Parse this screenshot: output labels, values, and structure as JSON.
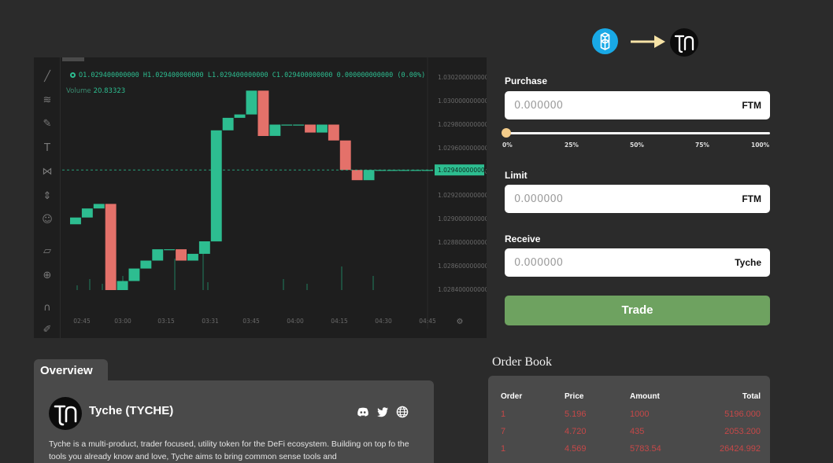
{
  "chart": {
    "ohlc": {
      "open_label": "O",
      "open": "1.029400000000",
      "high_label": "H",
      "high": "1.029400000000",
      "low_label": "L",
      "low": "1.029400000000",
      "close_label": "C",
      "close": "1.029400000000",
      "change": "0.000000000000 (0.00%)"
    },
    "volume_label": "Volume",
    "volume_value": "20.83323",
    "current_price": "1.029400000000",
    "y_ticks": [
      "1.030200000000",
      "1.030000000000",
      "1.029800000000",
      "1.029600000000",
      "1.029400000000",
      "1.029200000000",
      "1.029000000000",
      "1.028800000000",
      "1.028600000000",
      "1.028400000000"
    ],
    "x_ticks": [
      "02:45",
      "03:00",
      "03:15",
      "03:31",
      "03:45",
      "04:00",
      "04:15",
      "04:30",
      "04:45"
    ],
    "colors": {
      "up": "#2dbd90",
      "down": "#e4716a",
      "background": "#1e1e1e"
    },
    "tools": [
      "trend-line-icon",
      "fib-icon",
      "brush-icon",
      "text-icon",
      "pattern-icon",
      "measure-icon",
      "emoji-icon",
      "ruler-icon",
      "zoom-icon",
      "magnet-icon",
      "lock-icon"
    ]
  },
  "chart_data": {
    "type": "candlestick",
    "xlabel": "",
    "ylabel": "",
    "x": [
      "02:42",
      "02:45",
      "02:48",
      "02:51",
      "02:54",
      "03:00",
      "03:06",
      "03:12",
      "03:15",
      "03:18",
      "03:24",
      "03:27",
      "03:31",
      "03:36",
      "03:40",
      "03:45",
      "03:48",
      "03:54",
      "03:57",
      "04:00",
      "04:03",
      "04:06",
      "04:09",
      "04:12",
      "04:15",
      "04:18",
      "04:21",
      "04:24",
      "04:27",
      "04:30",
      "04:33"
    ],
    "open": [
      1.02892,
      1.02898,
      1.02906,
      1.0291,
      1.02834,
      1.02842,
      1.02853,
      1.0286,
      1.0287,
      1.0287,
      1.0286,
      1.02866,
      1.02877,
      1.02975,
      1.02986,
      1.02989,
      1.0301,
      1.0297,
      1.0298,
      1.0298,
      1.0298,
      1.02973,
      1.0298,
      1.02966,
      1.0294,
      1.02931,
      1.0294,
      1.0294,
      1.0294,
      1.0294,
      1.0294
    ],
    "close": [
      1.02898,
      1.02906,
      1.0291,
      1.02834,
      1.02842,
      1.02853,
      1.0286,
      1.0287,
      1.0287,
      1.0286,
      1.02866,
      1.02877,
      1.02975,
      1.02986,
      1.02989,
      1.0301,
      1.0297,
      1.0298,
      1.0298,
      1.0298,
      1.02973,
      1.0298,
      1.02966,
      1.0294,
      1.02931,
      1.0294,
      1.0294,
      1.0294,
      1.0294,
      1.0294,
      1.0294
    ],
    "ylim": [
      1.02834,
      1.03022
    ],
    "current": 1.0294
  },
  "header": {
    "from_token": "FTM",
    "to_token": "Tyche"
  },
  "form": {
    "purchase_label": "Purchase",
    "purchase_placeholder": "0.000000",
    "purchase_unit": "FTM",
    "slider_value": 0,
    "slider_ticks": [
      "0%",
      "25%",
      "50%",
      "75%",
      "100%"
    ],
    "limit_label": "Limit",
    "limit_placeholder": "0.000000",
    "limit_unit": "FTM",
    "receive_label": "Receive",
    "receive_placeholder": "0.000000",
    "receive_unit": "Tyche",
    "trade_label": "Trade"
  },
  "overview": {
    "tab_label": "Overview",
    "token_name": "Tyche (TYCHE)",
    "socials": [
      "discord-icon",
      "twitter-icon",
      "globe-icon"
    ],
    "description": "Tyche is a multi-product, trader focused, utility token for the DeFi ecosystem. Building on top fo the tools you already know and love, Tyche aims to bring common sense tools and"
  },
  "order_book": {
    "title": "Order Book",
    "headers": [
      "Order",
      "Price",
      "Amount",
      "Total"
    ],
    "rows": [
      [
        "1",
        "5.196",
        "1000",
        "5196.000"
      ],
      [
        "7",
        "4.720",
        "435",
        "2053.200"
      ],
      [
        "1",
        "4.569",
        "5783.54",
        "26424.992"
      ]
    ]
  }
}
